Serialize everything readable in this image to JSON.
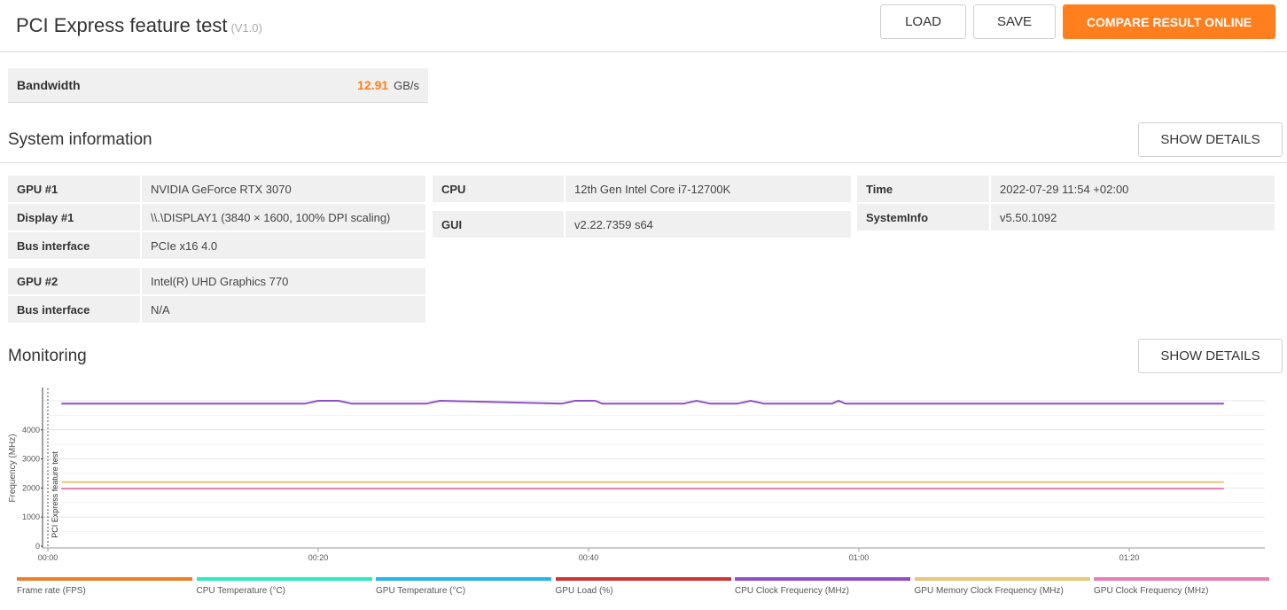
{
  "header": {
    "title": "PCI Express feature test",
    "version": "(V1.0)",
    "load_label": "LOAD",
    "save_label": "SAVE",
    "compare_label": "COMPARE RESULT ONLINE"
  },
  "bandwidth": {
    "label": "Bandwidth",
    "value": "12.91",
    "unit": "GB/s"
  },
  "system_info": {
    "title": "System information",
    "show_details_label": "SHOW DETAILS",
    "col1": {
      "gpu1_key": "GPU #1",
      "gpu1_val": "NVIDIA GeForce RTX 3070",
      "display1_key": "Display #1",
      "display1_val": "\\\\.\\DISPLAY1 (3840 × 1600, 100% DPI scaling)",
      "bus1_key": "Bus interface",
      "bus1_val": "PCIe x16 4.0",
      "gpu2_key": "GPU #2",
      "gpu2_val": "Intel(R) UHD Graphics 770",
      "bus2_key": "Bus interface",
      "bus2_val": "N/A"
    },
    "col2": {
      "cpu_key": "CPU",
      "cpu_val": "12th Gen Intel Core i7-12700K",
      "gui_key": "GUI",
      "gui_val": "v2.22.7359 s64"
    },
    "col3": {
      "time_key": "Time",
      "time_val": "2022-07-29 11:54 +02:00",
      "sysinfo_key": "SystemInfo",
      "sysinfo_val": "v5.50.1092"
    }
  },
  "monitoring": {
    "title": "Monitoring",
    "show_details_label": "SHOW DETAILS"
  },
  "chart_data": {
    "type": "line",
    "ylabel": "Frequency (MHz)",
    "annotation": "PCI Express feature test",
    "ylim": [
      0,
      5000
    ],
    "yticks": [
      "0",
      "1000",
      "2000",
      "3000",
      "4000"
    ],
    "xticks": [
      "00:00",
      "00:20",
      "00:40",
      "01:00",
      "01:20"
    ],
    "xlim_seconds": [
      0,
      90
    ],
    "series": [
      {
        "name": "CPU Clock Frequency (MHz)",
        "color": "#8e4fc8",
        "x": [
          1,
          19,
          20,
          21.5,
          22.5,
          28,
          29,
          38,
          39,
          40.5,
          41,
          47,
          48,
          49,
          51,
          52,
          53,
          58,
          58.5,
          59,
          59.5,
          87
        ],
        "y": [
          4900,
          4900,
          5000,
          5000,
          4900,
          4900,
          5000,
          4900,
          5000,
          5000,
          4900,
          4900,
          5000,
          4900,
          4900,
          5000,
          4900,
          4900,
          5000,
          4900,
          4900,
          4900
        ]
      },
      {
        "name": "GPU Memory Clock Frequency (MHz)",
        "color": "#e8c77a",
        "x": [
          1,
          87
        ],
        "y": [
          2200,
          2200
        ]
      },
      {
        "name": "GPU Clock Frequency (MHz)",
        "color": "#e67fb4",
        "x": [
          1,
          87
        ],
        "y": [
          1980,
          1980
        ]
      }
    ],
    "legend": [
      {
        "name": "Frame rate (FPS)",
        "color": "#ee7d2a"
      },
      {
        "name": "CPU Temperature (°C)",
        "color": "#2de8c0"
      },
      {
        "name": "GPU Temperature (°C)",
        "color": "#25b5ee"
      },
      {
        "name": "GPU Load (%)",
        "color": "#cf3434"
      },
      {
        "name": "CPU Clock Frequency (MHz)",
        "color": "#8e4fc8"
      },
      {
        "name": "GPU Memory Clock Frequency (MHz)",
        "color": "#e8c77a"
      },
      {
        "name": "GPU Clock Frequency (MHz)",
        "color": "#e67fb4"
      }
    ]
  }
}
